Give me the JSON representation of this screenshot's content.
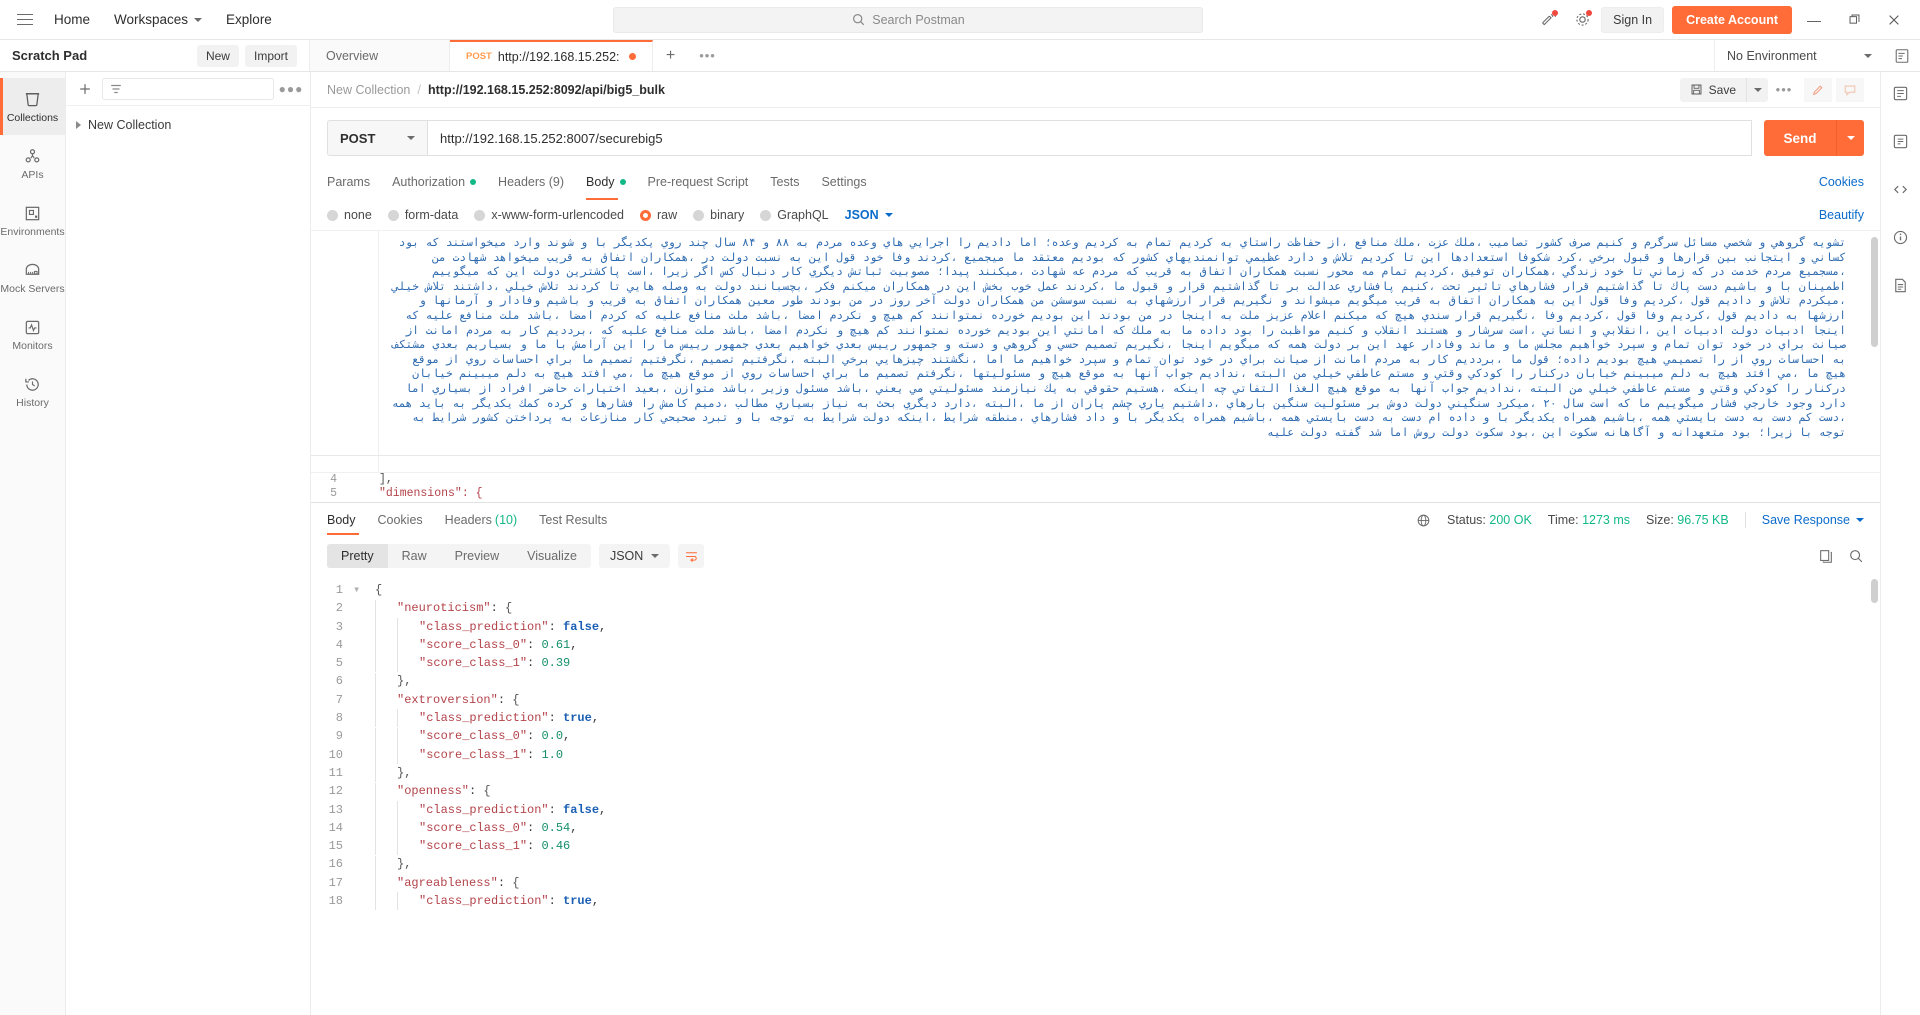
{
  "topbar": {
    "menu_icon": "hamburger-icon",
    "home": "Home",
    "workspaces": "Workspaces",
    "explore": "Explore",
    "search_placeholder": "Search Postman",
    "search_icon": "search-icon",
    "invite_icon": "invite-icon",
    "settings_icon": "gear-icon",
    "sign_in": "Sign In",
    "create_account": "Create Account",
    "minimize": "minimize-icon",
    "maximize": "maximize-icon",
    "close": "close-icon",
    "accent": "#ff6c37"
  },
  "secondbar": {
    "scratch_pad": "Scratch Pad",
    "new": "New",
    "import": "Import",
    "tabs": [
      {
        "label": "Overview",
        "method": "",
        "active": false,
        "unsaved": false
      },
      {
        "label": "http://192.168.15.252:",
        "method": "POST",
        "active": true,
        "unsaved": true
      }
    ],
    "add_tab": "+",
    "tab_more": "•••",
    "environment": "No Environment",
    "env_icon": "environment-quick-look-icon"
  },
  "rail": {
    "items": [
      {
        "label": "Collections",
        "icon": "collections-icon",
        "active": true
      },
      {
        "label": "APIs",
        "icon": "apis-icon",
        "active": false
      },
      {
        "label": "Environments",
        "icon": "environments-icon",
        "active": false
      },
      {
        "label": "Mock Servers",
        "icon": "mock-servers-icon",
        "active": false
      },
      {
        "label": "Monitors",
        "icon": "monitors-icon",
        "active": false
      },
      {
        "label": "History",
        "icon": "history-icon",
        "active": false
      }
    ]
  },
  "sidebar": {
    "new_icon": "plus-icon",
    "filter_icon": "filter-icon",
    "more_icon": "more-icon",
    "tree": [
      {
        "label": "New Collection"
      }
    ]
  },
  "breadcrumb": {
    "collection": "New Collection",
    "separator": "/",
    "request": "http://192.168.15.252:8092/api/big5_bulk",
    "save_label": "Save",
    "save_icon": "save-icon",
    "more": "•••",
    "edit_icon": "pencil-icon",
    "comment_icon": "comment-icon"
  },
  "request": {
    "method": "POST",
    "url": "http://192.168.15.252:8007/securebig5",
    "send": "Send",
    "tabs": [
      {
        "label": "Params",
        "active": false,
        "dot": false,
        "count": ""
      },
      {
        "label": "Authorization",
        "active": false,
        "dot": true,
        "count": ""
      },
      {
        "label": "Headers (9)",
        "active": false,
        "dot": false,
        "count": ""
      },
      {
        "label": "Body",
        "active": true,
        "dot": true,
        "count": ""
      },
      {
        "label": "Pre-request Script",
        "active": false,
        "dot": false,
        "count": ""
      },
      {
        "label": "Tests",
        "active": false,
        "dot": false,
        "count": ""
      },
      {
        "label": "Settings",
        "active": false,
        "dot": false,
        "count": ""
      }
    ],
    "cookies_link": "Cookies",
    "body_types": [
      {
        "label": "none",
        "selected": false
      },
      {
        "label": "form-data",
        "selected": false
      },
      {
        "label": "x-www-form-urlencoded",
        "selected": false
      },
      {
        "label": "raw",
        "selected": true
      },
      {
        "label": "binary",
        "selected": false
      },
      {
        "label": "GraphQL",
        "selected": false
      }
    ],
    "raw_format": "JSON",
    "beautify": "Beautify",
    "editor_text": "تشويه گروهي و شخصي مسائل سرگرم و كنيم صرف كشور تصاميب ،ملك عزت ،ملك منافع ،از حفاظت راستاي به كرديم تمام به كرديم وعده؛ اما داديم را اجرايي هاي وعده مردم به ۸۸ و ۸۴ سال چند روي يكديگر با و شوند وارد ميخواستند كه بود كساني و ايتجانب بين قرارها و قبول برخي ،كرد شكوفا استعدادها اين تا كرديم تلاش و دارد عظيمي توانمنديهاي كشور كه بوديم معتقد ما ميجميع ،كردند وفا خود قول اين به نسبت دولت در ،همكاران اتفاق به قريب ميخواهد شهادت من ،مسجميع مردم خدمت در كه زماني تا خود زندگي ،همكاران توفيق ،كرديم تمام مه محور نسبت همكاران اتفاق به قريب كه مردم عه شهادت ،ميكنند پيدا؛ مصوبيت ثباتش ديگري كار دنبال كس اگر زيرا ،است پاكشترين دولت اين كه ميگوييم اطمينان با و باشيم دست پاك تا گذاشتيم قرار فشارهاي تاثير تحت ،كنيم پافشاري عدالت بر تا گذاشتيم قرار و قبول ما ،كردند عمل خوب بخش اين در همكاران ميكنم فكر ،بچسبانند دولت به وصله هايي تا كردند تلاش خيلي ،داشتند تلاش خيلي ،ميكردم تلاش و داديم قول ،كرديم وفا قول اين به همكاران اتفاق به قريب ميگويم ميشواند و نگيريم قرار ارزشهاي به نسبت سوسشن من همكاران دولت آخر روز در من بودند طور معين همكاران اتفاق به قريب و باشيم وفادار و آرمانها و ارزشها به داديم قول ،كرديم وفا قول ،كرديم وفا ،نگيريم قرار سندي هيچ كه ميكنم اعلام عزيز ملت به اينجا در من بودند اين بوديم خورده نمتوانند كم هيچ و نكردم امضا ،باشد ملت منافع عليه كه كردم امضا ،باشد ملت منافع عليه كه اينجا ادبيات دولت ادبيات اين ،انقلابي و انساني ،است سرشار و هستند انقلاب و كنيم مواظبت را بود داده ما به ملك كه امانتي اين بوديم خورده نمتوانند كم هيچ و نكردم امضا ،باشد ملت منافع عليه كه ،بردديم كار به مردم امانت از صيانت براي در خود توان تمام و سپرد خواهيم مجلس ما و ماند وفادار عهد اين بر دولت همه كه ميگويم اينجا ،نگيريم تصميم حسي و گروهي و دسته و جمهور رييس بعدي خواهيم بعدي جمهور رييس ما را اين آرامش با ما و بسياريم بعدي مشتكف به احساسات روي از را تصميمي هيچ بوديم داده؛ قول ما ،بردديم كار به مردم امانت از صيانت براي در خود توان تمام و سپرد خواهيم ما اما ،نگشتند چيزهايي برخي البته ،نگرفتيم تصميم ،نگرفتيم تصميم ما براي احساسات روي از موقع هيچ ما ،مي افتد هيچ به دلم ميبينم خيابان دركنار را كودكي وقتي و مستم عاطفي خيلي من البته ،نداديم جواب آنها به موقع هيچ و مسئوليتها ،نگرفتم تصميم ما براي احساسات روي از موقع هيچ ما ،مي افتد هيچ به دلم ميبينم خيابان دركنار را كودكي وقتي و مستم عاطفي خيلي من البته ،نداديم جواب آنها به موقع هيچ الغذا التفاتي چه اينكه ،هستيم حقوقي به يك نيازمند مسئوليتي مي يعني ،باشد مسئول وزير ،باشد متوازن ،بعيد اختيارات حاضر افراد از بسياري اما دارد وجود خارجي فشار ميگوييم ما كه است سال ۲۰ ،ميكرد سنگيني دولت دوش بر مسئوليت سنگين بارهاي ،داشتيم ياري چشم ياران از ما ،البته ،دارد ديگري بحث به نياز بسياري مطالب ،دميم كامش را فشارها و كرده كمك يكديگر به بايد همه ،دست كم دست به دست بايستي همه ،باشيم همراه يكديگر با و داده ام دست به دست بايستي همه ،باشيم همراه يكديگر با و داد فشارهاي ،منطقه شرايط ،اينكه دولت شرايط به توجه با و تبرد صحيحي كار منازعات به پرداختن كشور شرايط به توجه با زيرا؛ بود متعهدانه و آگاهانه سكوت اين ،بود سكوت دولت روش اما شد گفته دولت عليه",
    "editor_last_lines": [
      {
        "num": "4",
        "text": "],",
        "indent": 1
      },
      {
        "num": "5",
        "text": "\"dimensions\": {",
        "indent": 1
      }
    ]
  },
  "response": {
    "tabs": [
      {
        "label": "Body",
        "active": true,
        "count": ""
      },
      {
        "label": "Cookies",
        "active": false,
        "count": ""
      },
      {
        "label": "Headers",
        "active": false,
        "count": "(10)"
      },
      {
        "label": "Test Results",
        "active": false,
        "count": ""
      }
    ],
    "globe_icon": "globe-icon",
    "status_label": "Status:",
    "status_value": "200 OK",
    "time_label": "Time:",
    "time_value": "1273 ms",
    "size_label": "Size:",
    "size_value": "96.75 KB",
    "save_response": "Save Response",
    "view_modes": [
      {
        "label": "Pretty",
        "active": true
      },
      {
        "label": "Raw",
        "active": false
      },
      {
        "label": "Preview",
        "active": false
      },
      {
        "label": "Visualize",
        "active": false
      }
    ],
    "format": "JSON",
    "wrap_icon": "wrap-lines-icon",
    "copy_icon": "copy-icon",
    "search_icon": "search-icon",
    "json_lines": [
      {
        "num": 1,
        "indent": 0,
        "tokens": [
          {
            "t": "{",
            "c": "brace"
          }
        ]
      },
      {
        "num": 2,
        "indent": 1,
        "tokens": [
          {
            "t": "\"neuroticism\"",
            "c": "key"
          },
          {
            "t": ": ",
            "c": "punc"
          },
          {
            "t": "{",
            "c": "brace"
          }
        ]
      },
      {
        "num": 3,
        "indent": 2,
        "tokens": [
          {
            "t": "\"class_prediction\"",
            "c": "key"
          },
          {
            "t": ": ",
            "c": "punc"
          },
          {
            "t": "false",
            "c": "bool"
          },
          {
            "t": ",",
            "c": "punc"
          }
        ]
      },
      {
        "num": 4,
        "indent": 2,
        "tokens": [
          {
            "t": "\"score_class_0\"",
            "c": "key"
          },
          {
            "t": ": ",
            "c": "punc"
          },
          {
            "t": "0.61",
            "c": "num"
          },
          {
            "t": ",",
            "c": "punc"
          }
        ]
      },
      {
        "num": 5,
        "indent": 2,
        "tokens": [
          {
            "t": "\"score_class_1\"",
            "c": "key"
          },
          {
            "t": ": ",
            "c": "punc"
          },
          {
            "t": "0.39",
            "c": "num"
          }
        ]
      },
      {
        "num": 6,
        "indent": 1,
        "tokens": [
          {
            "t": "},",
            "c": "brace"
          }
        ]
      },
      {
        "num": 7,
        "indent": 1,
        "tokens": [
          {
            "t": "\"extroversion\"",
            "c": "key"
          },
          {
            "t": ": ",
            "c": "punc"
          },
          {
            "t": "{",
            "c": "brace"
          }
        ]
      },
      {
        "num": 8,
        "indent": 2,
        "tokens": [
          {
            "t": "\"class_prediction\"",
            "c": "key"
          },
          {
            "t": ": ",
            "c": "punc"
          },
          {
            "t": "true",
            "c": "bool"
          },
          {
            "t": ",",
            "c": "punc"
          }
        ]
      },
      {
        "num": 9,
        "indent": 2,
        "tokens": [
          {
            "t": "\"score_class_0\"",
            "c": "key"
          },
          {
            "t": ": ",
            "c": "punc"
          },
          {
            "t": "0.0",
            "c": "num"
          },
          {
            "t": ",",
            "c": "punc"
          }
        ]
      },
      {
        "num": 10,
        "indent": 2,
        "tokens": [
          {
            "t": "\"score_class_1\"",
            "c": "key"
          },
          {
            "t": ": ",
            "c": "punc"
          },
          {
            "t": "1.0",
            "c": "num"
          }
        ]
      },
      {
        "num": 11,
        "indent": 1,
        "tokens": [
          {
            "t": "},",
            "c": "brace"
          }
        ]
      },
      {
        "num": 12,
        "indent": 1,
        "tokens": [
          {
            "t": "\"openness\"",
            "c": "key"
          },
          {
            "t": ": ",
            "c": "punc"
          },
          {
            "t": "{",
            "c": "brace"
          }
        ]
      },
      {
        "num": 13,
        "indent": 2,
        "tokens": [
          {
            "t": "\"class_prediction\"",
            "c": "key"
          },
          {
            "t": ": ",
            "c": "punc"
          },
          {
            "t": "false",
            "c": "bool"
          },
          {
            "t": ",",
            "c": "punc"
          }
        ]
      },
      {
        "num": 14,
        "indent": 2,
        "tokens": [
          {
            "t": "\"score_class_0\"",
            "c": "key"
          },
          {
            "t": ": ",
            "c": "punc"
          },
          {
            "t": "0.54",
            "c": "num"
          },
          {
            "t": ",",
            "c": "punc"
          }
        ]
      },
      {
        "num": 15,
        "indent": 2,
        "tokens": [
          {
            "t": "\"score_class_1\"",
            "c": "key"
          },
          {
            "t": ": ",
            "c": "punc"
          },
          {
            "t": "0.46",
            "c": "num"
          }
        ]
      },
      {
        "num": 16,
        "indent": 1,
        "tokens": [
          {
            "t": "},",
            "c": "brace"
          }
        ]
      },
      {
        "num": 17,
        "indent": 1,
        "tokens": [
          {
            "t": "\"agreableness\"",
            "c": "key"
          },
          {
            "t": ": ",
            "c": "punc"
          },
          {
            "t": "{",
            "c": "brace"
          }
        ]
      },
      {
        "num": 18,
        "indent": 2,
        "tokens": [
          {
            "t": "\"class_prediction\"",
            "c": "key"
          },
          {
            "t": ": ",
            "c": "punc"
          },
          {
            "t": "true",
            "c": "bool"
          },
          {
            "t": ",",
            "c": "punc"
          }
        ]
      }
    ]
  },
  "railright": {
    "items": [
      {
        "icon": "capture-requests-icon"
      },
      {
        "icon": "runner-icon"
      },
      {
        "icon": "code-snippet-icon"
      },
      {
        "icon": "info-icon"
      },
      {
        "icon": "documentation-icon"
      }
    ]
  }
}
